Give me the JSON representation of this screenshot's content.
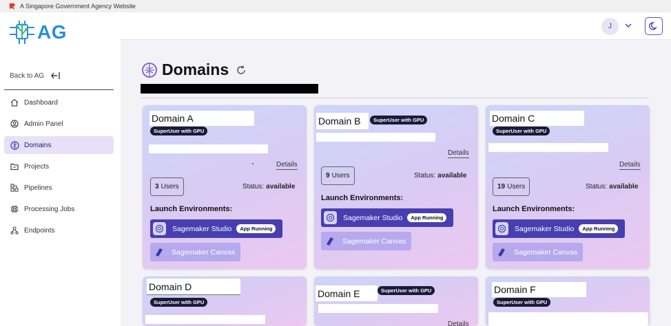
{
  "gov_banner": {
    "text": "A Singapore Government Agency Website"
  },
  "brand": {
    "logo_text": "AG",
    "accent": "#2a8fd6"
  },
  "sidebar": {
    "back_label": "Back to AG",
    "items": [
      {
        "label": "Dashboard",
        "icon": "home-icon",
        "active": false
      },
      {
        "label": "Admin Panel",
        "icon": "user-circle-icon",
        "active": false
      },
      {
        "label": "Domains",
        "icon": "brain-icon",
        "active": true
      },
      {
        "label": "Projects",
        "icon": "folder-icon",
        "active": false
      },
      {
        "label": "Pipelines",
        "icon": "pipeline-icon",
        "active": false
      },
      {
        "label": "Processing Jobs",
        "icon": "cpu-icon",
        "active": false
      },
      {
        "label": "Endpoints",
        "icon": "endpoint-icon",
        "active": false
      }
    ]
  },
  "topbar": {
    "avatar_initial": "J"
  },
  "page": {
    "title": "Domains"
  },
  "colors": {
    "studio_button": "#473fb0",
    "canvas_button": "#b6a9ee",
    "badge": "#1a1a3a",
    "active_nav": "#e6e1f7"
  },
  "domains": [
    {
      "name": "Domain A",
      "badge": "SuperUser with GPU",
      "details": "Details",
      "users_count": "3",
      "users_label": "Users",
      "status_label": "Status:",
      "status_value": "available",
      "launch_label": "Launch Environments:",
      "studio_label": "Sagemaker Studio",
      "studio_status": "App Running",
      "canvas_label": "Sagemaker Canvas"
    },
    {
      "name": "Domain B",
      "badge": "SuperUser with GPU",
      "details": "Details",
      "users_count": "9",
      "users_label": "Users",
      "status_label": "Status:",
      "status_value": "available",
      "launch_label": "Launch Environments:",
      "studio_label": "Sagemaker Studio",
      "studio_status": "App Running",
      "canvas_label": "Sagemaker Canvas"
    },
    {
      "name": "Domain C",
      "badge": "SuperUser with GPU",
      "details": "Details",
      "users_count": "19",
      "users_label": "Users",
      "status_label": "Status:",
      "status_value": "available",
      "launch_label": "Launch Environments:",
      "studio_label": "Sagemaker Studio",
      "studio_status": "App Running",
      "canvas_label": "Sagemaker Canvas"
    },
    {
      "name": "Domain D",
      "badge": "SuperUser with GPU"
    },
    {
      "name": "Domain E",
      "badge": "SuperUser with GPU",
      "details": "Details"
    },
    {
      "name": "Domain F",
      "badge": "SuperUser with GPU"
    }
  ]
}
